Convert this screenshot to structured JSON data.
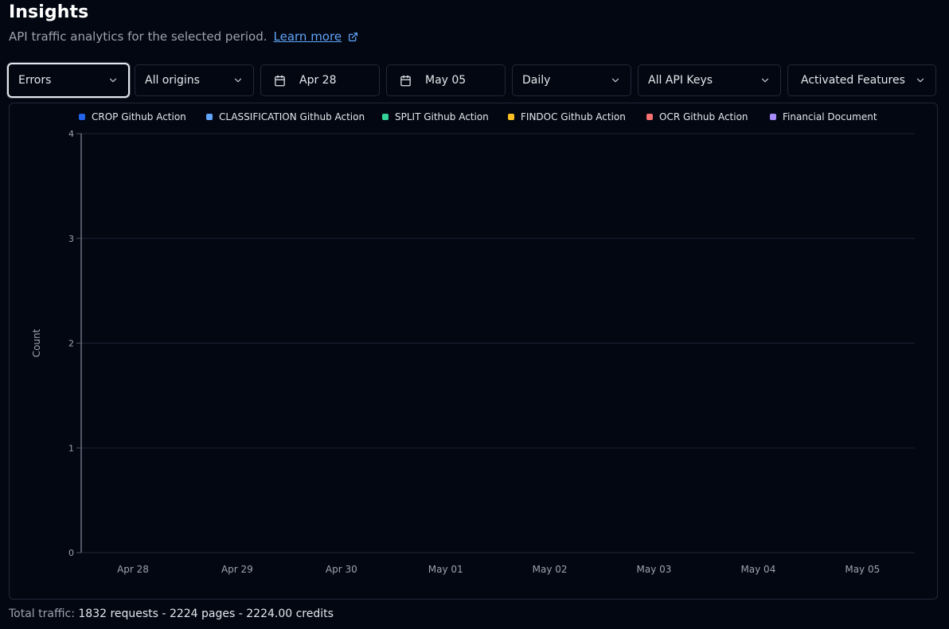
{
  "header": {
    "title": "Insights",
    "subtitle": "API traffic analytics for the selected period.",
    "learn_more": "Learn more",
    "learn_more_icon": "external-link-icon"
  },
  "filters": {
    "metric": "Errors",
    "origin": "All origins",
    "start_date": "Apr 28",
    "end_date": "May 05",
    "granularity": "Daily",
    "api_keys": "All API Keys",
    "features": "Activated Features"
  },
  "colors": {
    "background": "#030712",
    "border": "#1f2937",
    "link": "#60a5fa"
  },
  "chart_data": {
    "type": "line",
    "ylabel": "Count",
    "xlabel": "",
    "ylim": [
      0,
      4
    ],
    "y_ticks": [
      "0",
      "1",
      "2",
      "3",
      "4"
    ],
    "categories": [
      "Apr 28",
      "Apr 29",
      "Apr 30",
      "May 01",
      "May 02",
      "May 03",
      "May 04",
      "May 05"
    ],
    "grid": true,
    "legend_position": "top",
    "series": [
      {
        "name": "CROP Github Action",
        "color": "#2563eb",
        "values": []
      },
      {
        "name": "CLASSIFICATION Github Action",
        "color": "#60a5fa",
        "values": []
      },
      {
        "name": "SPLIT Github Action",
        "color": "#34d399",
        "values": []
      },
      {
        "name": "FINDOC Github Action",
        "color": "#fbbf24",
        "values": []
      },
      {
        "name": "OCR Github Action",
        "color": "#f87171",
        "values": []
      },
      {
        "name": "Financial Document",
        "color": "#a78bfa",
        "values": []
      }
    ]
  },
  "footer": {
    "prefix": "Total traffic:",
    "requests": "1832 requests",
    "pages": "2224 pages",
    "credits": "2224.00 credits",
    "separator": "-"
  }
}
